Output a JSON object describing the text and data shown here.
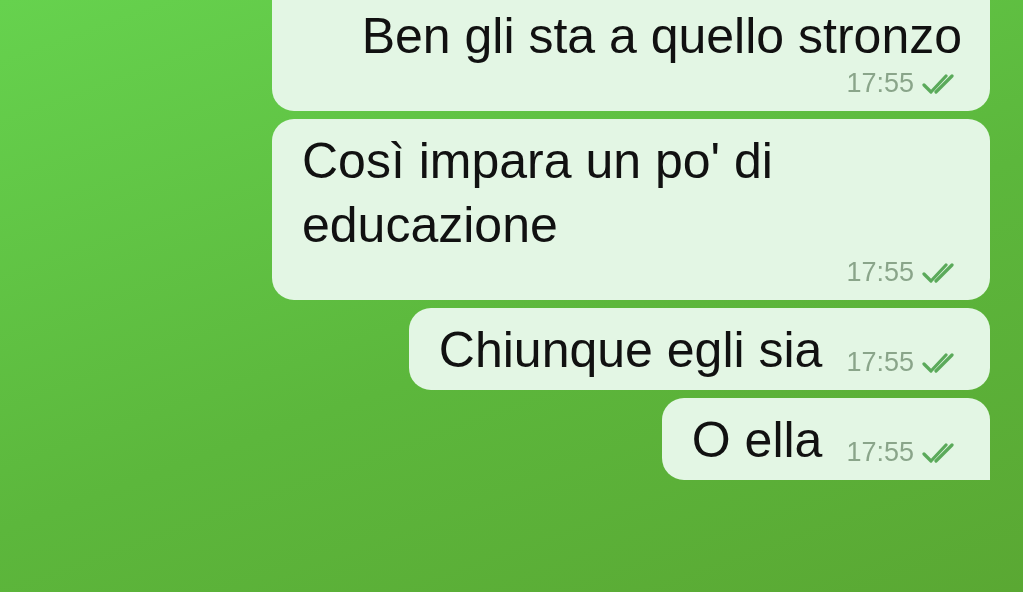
{
  "messages": [
    {
      "text": "Ben gli sta a quello stronzo",
      "time": "17:55",
      "read": true
    },
    {
      "text": "Così impara un po' di educazione",
      "time": "17:55",
      "read": true
    },
    {
      "text": "Chiunque egli sia",
      "time": "17:55",
      "read": true
    },
    {
      "text": "O ella",
      "time": "17:55",
      "read": true
    }
  ]
}
